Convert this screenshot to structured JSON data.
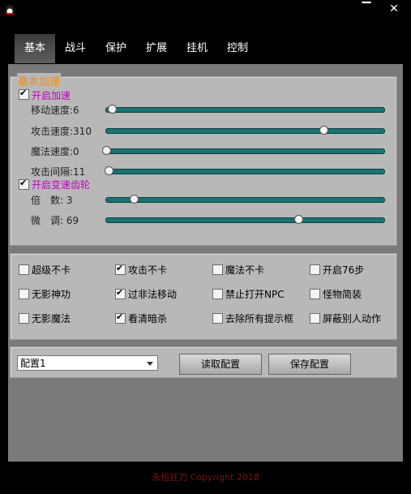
{
  "window": {
    "minimize_glyph": "▔",
    "close_glyph": "✕"
  },
  "tabs": [
    {
      "label": "基本",
      "active": true
    },
    {
      "label": "战斗",
      "active": false
    },
    {
      "label": "保护",
      "active": false
    },
    {
      "label": "扩展",
      "active": false
    },
    {
      "label": "挂机",
      "active": false
    },
    {
      "label": "控制",
      "active": false
    }
  ],
  "basic_speed": {
    "title": "基本加速",
    "enable_speed": {
      "label": "开启加速",
      "checked": true
    },
    "sliders": [
      {
        "label": "移动速度:6",
        "value": 0.02
      },
      {
        "label": "攻击速度:310",
        "value": 0.78
      },
      {
        "label": "魔法速度:0",
        "value": 0.0
      },
      {
        "label": "攻击间隔:11",
        "value": 0.01
      }
    ],
    "enable_gear": {
      "label": "开启变速齿轮",
      "checked": true
    },
    "gear_sliders": [
      {
        "label": "倍　数: 3",
        "value": 0.1
      },
      {
        "label": "微　调: 69",
        "value": 0.69
      }
    ]
  },
  "options": [
    {
      "label": "超级不卡",
      "checked": false
    },
    {
      "label": "攻击不卡",
      "checked": true
    },
    {
      "label": "魔法不卡",
      "checked": false
    },
    {
      "label": "开启76步",
      "checked": false
    },
    {
      "label": "无影神功",
      "checked": false
    },
    {
      "label": "过非法移动",
      "checked": true
    },
    {
      "label": "禁止打开NPC",
      "checked": false
    },
    {
      "label": "怪物简装",
      "checked": false
    },
    {
      "label": "无影魔法",
      "checked": false
    },
    {
      "label": "看清暗杀",
      "checked": true
    },
    {
      "label": "去除所有提示框",
      "checked": false
    },
    {
      "label": "屏蔽别人动作",
      "checked": false
    }
  ],
  "config": {
    "selected": "配置1",
    "load_label": "读取配置",
    "save_label": "保存配置"
  },
  "footer": "永恒狂刀    Copyright 2018",
  "colors": {
    "accent_title": "#ff8a00",
    "magenta": "#c000c0",
    "track": "#1a7373",
    "footer": "#7a1212"
  },
  "icons": [
    "app-icon",
    "minimize-icon",
    "close-icon",
    "check-icon",
    "dropdown-arrow-icon"
  ]
}
